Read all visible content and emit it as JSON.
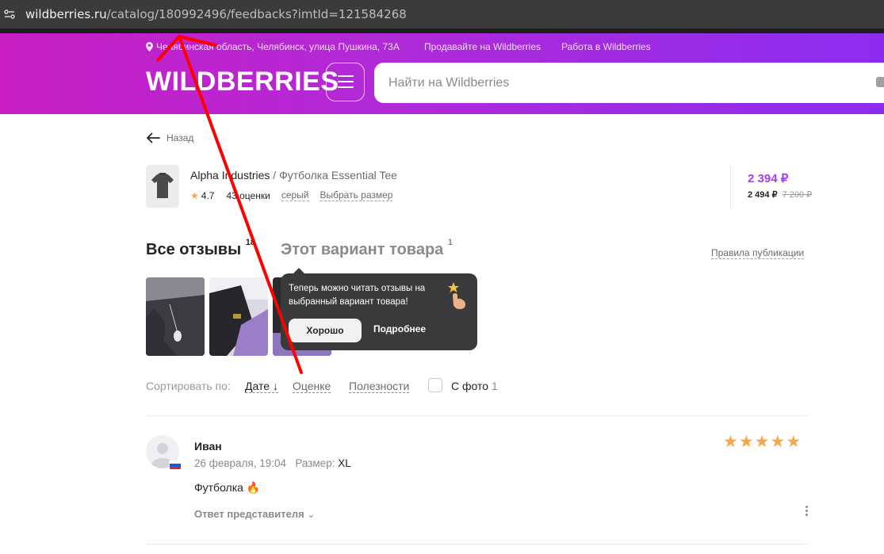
{
  "browser": {
    "url_host": "wildberries.ru",
    "url_path": "/catalog/180992496/feedbacks?imtId=121584268"
  },
  "header": {
    "location": "Челябинская область, Челябинск, улица Пушкина, 73А",
    "sell_link": "Продавайте на Wildberries",
    "jobs_link": "Работа в Wildberries",
    "logo": "WILDBERRIES",
    "search_placeholder": "Найти на Wildberries"
  },
  "back": {
    "label": "Назад"
  },
  "product": {
    "brand": "Alpha Industries",
    "name": " / Футболка Essential Tee",
    "rating": "4.7",
    "reviews_count": "43 оценки",
    "color": "серый",
    "size_link": "Выбрать размер",
    "price": "2 394 ₽",
    "price_wallet": "2 494 ₽",
    "price_old": "7 200 ₽"
  },
  "tabs": {
    "all_label": "Все отзывы",
    "all_count": "18",
    "variant_label": "Этот вариант товара",
    "variant_count": "1",
    "rules_link": "Правила публикации"
  },
  "tooltip": {
    "text": "Теперь можно читать отзывы на выбранный вариант товара!",
    "ok_label": "Хорошо",
    "more_label": "Подробнее"
  },
  "sort": {
    "label": "Сортировать по:",
    "options": [
      "Дате",
      "Оценке",
      "Полезности"
    ],
    "with_photo_label": "С фото",
    "with_photo_count": "1"
  },
  "review": {
    "author": "Иван",
    "date": "26 февраля, 19:04",
    "size_label": "Размер:",
    "size_value": "XL",
    "text": "Футболка 🔥",
    "rating": 5,
    "reply_label": "Ответ представителя"
  },
  "colors": {
    "accent": "#a73afd",
    "star": "#f6a74d",
    "annotation": "#ff0000"
  }
}
